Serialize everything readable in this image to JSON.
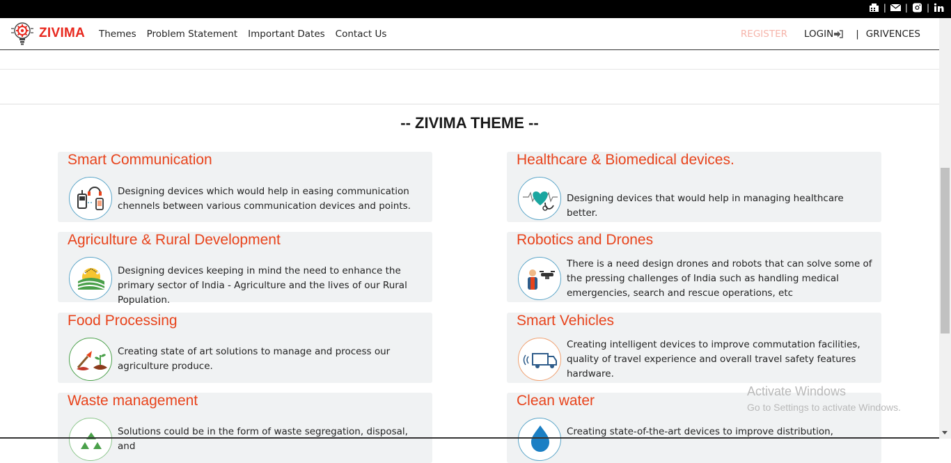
{
  "brand": {
    "name": "ZIVIMA",
    "color": "#e8281e"
  },
  "nav": {
    "items": [
      "Themes",
      "Problem Statement",
      "Important Dates",
      "Contact Us"
    ],
    "register": "REGISTER",
    "login": "LOGIN",
    "separator": "|",
    "grievences": "GRIVENCES"
  },
  "topbar": {
    "icons": [
      "fax-icon",
      "mail-icon",
      "instagram-icon",
      "linkedin-icon"
    ],
    "separator": "|"
  },
  "section": {
    "heading": "-- ZIVIMA THEME --"
  },
  "themes": [
    {
      "title": "Smart Communication",
      "desc": "Designing devices which would help in easing communication chennels between various communication devices and points.",
      "icon": "communication-icon"
    },
    {
      "title": "Healthcare & Biomedical devices.",
      "desc": "Designing devices that would help in managing healthcare better.",
      "icon": "healthcare-icon"
    },
    {
      "title": "Agriculture & Rural Development",
      "desc": "Designing devices keeping in mind the need to enhance the primary sector of India - Agriculture and the lives of our Rural Population.",
      "icon": "agriculture-icon"
    },
    {
      "title": "Robotics and Drones",
      "desc": "There is a need design drones and robots that can solve some of the pressing challenges of India such as handling medical emergencies, search and rescue operations, etc",
      "icon": "robotics-icon"
    },
    {
      "title": "Food Processing",
      "desc": "Creating state of art solutions to manage and process our agriculture produce.",
      "icon": "food-processing-icon"
    },
    {
      "title": "Smart Vehicles",
      "desc": "Creating intelligent devices to improve commutation facilities, quality of travel experience and overall travel safety features hardware.",
      "icon": "vehicle-icon"
    },
    {
      "title": "Waste management",
      "desc": "Solutions could be in the form of waste segregation, disposal, and",
      "icon": "recycle-icon"
    },
    {
      "title": "Clean water",
      "desc": "Creating state-of-the-art devices to improve distribution,",
      "icon": "water-drop-icon"
    }
  ],
  "watermark": {
    "line1": "Activate Windows",
    "line2": "Go to Settings to activate Windows."
  },
  "colors": {
    "accent": "#e8431b",
    "card_bg": "#f0f2f3"
  }
}
